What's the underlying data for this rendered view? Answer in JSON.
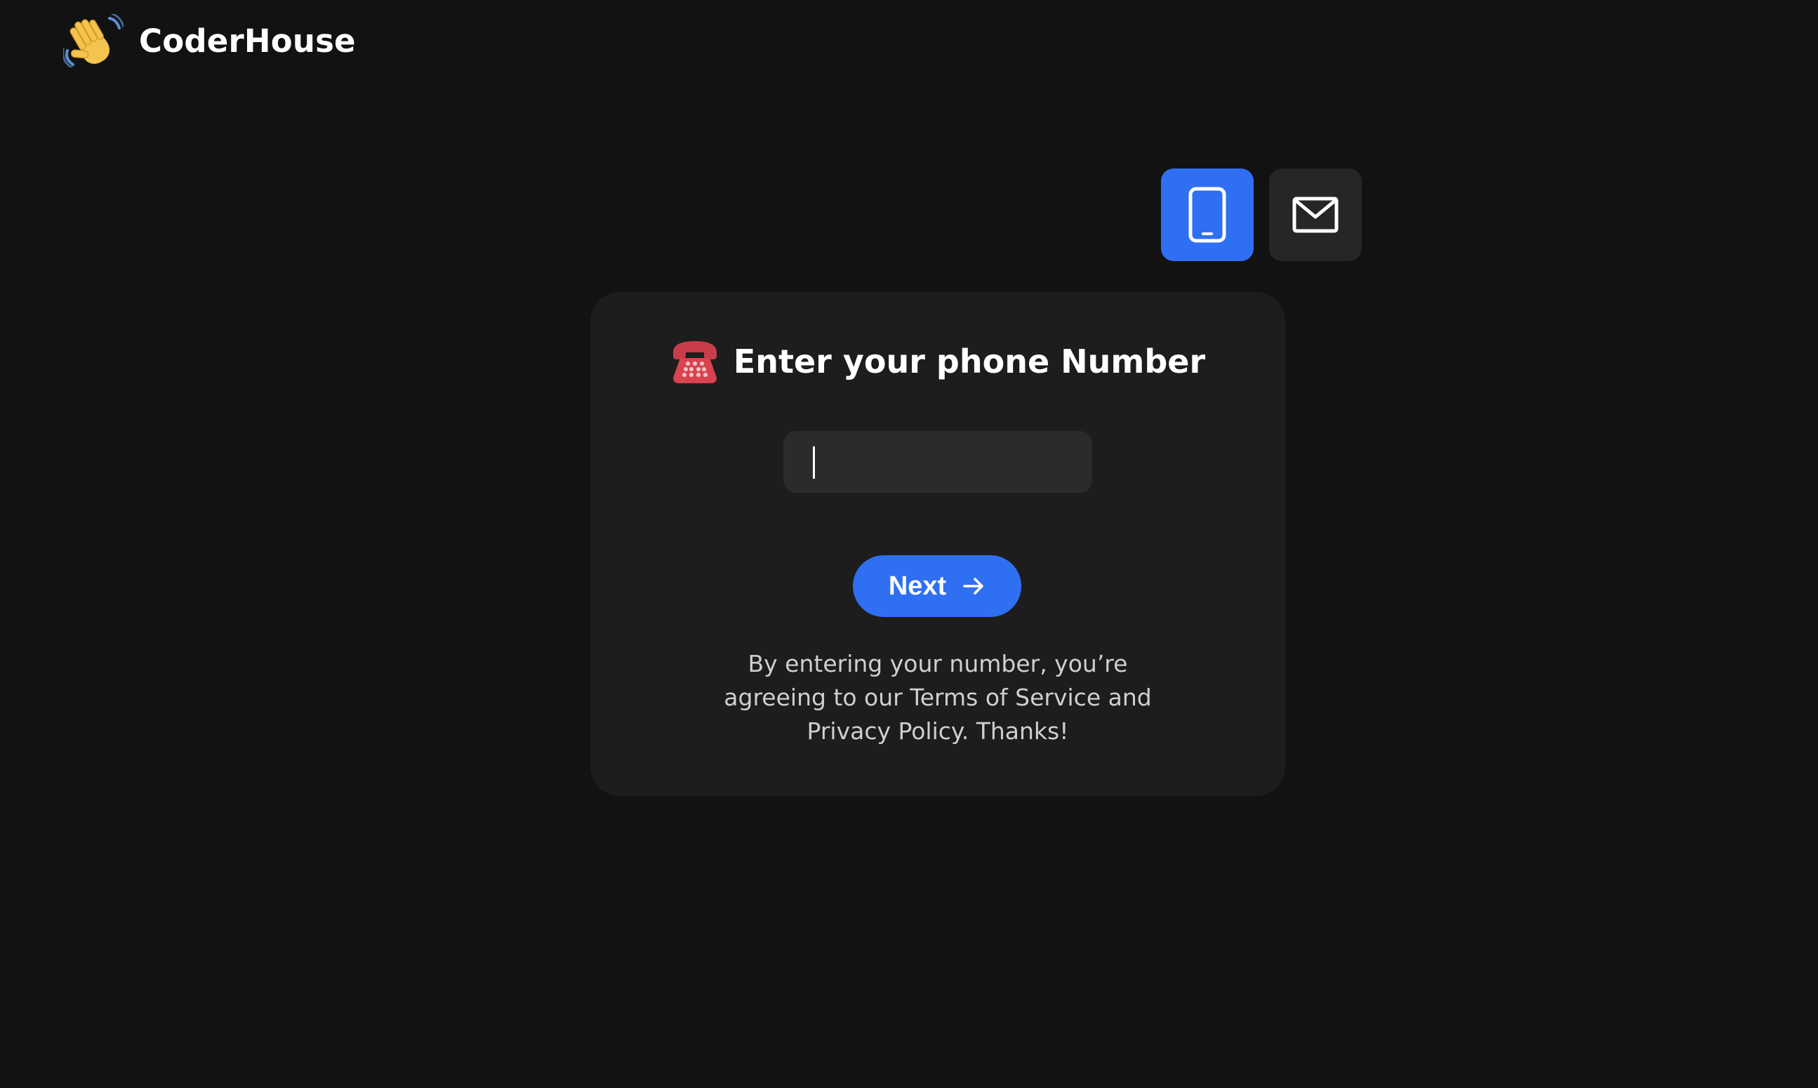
{
  "app": {
    "brand_name": "CoderHouse",
    "brand_icon": "waving-hand-icon"
  },
  "mode_switch": {
    "options": [
      {
        "id": "phone",
        "icon": "phone-icon",
        "active": true
      },
      {
        "id": "email",
        "icon": "mail-icon",
        "active": false
      }
    ]
  },
  "card": {
    "icon": "telephone-icon",
    "title": "Enter your phone Number",
    "phone_input": {
      "value": "",
      "placeholder": ""
    },
    "next_label": "Next",
    "disclaimer": "By entering your number, you’re agreeing to our Terms of Service and Privacy Policy. Thanks!"
  },
  "colors": {
    "background": "#121212",
    "card": "#1d1d1d",
    "accent": "#2f6ff2",
    "input_bg": "#2b2b2b",
    "inactive_button": "#262626"
  }
}
